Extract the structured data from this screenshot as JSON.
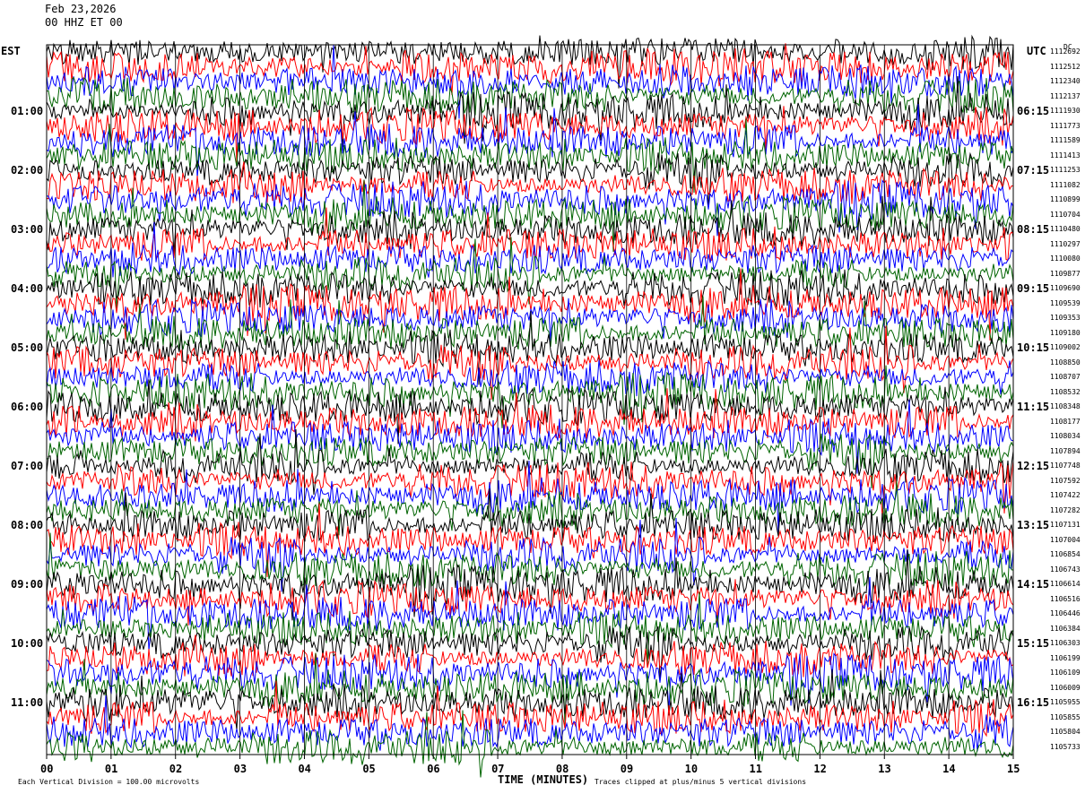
{
  "header": {
    "date": "Feb 23,2026",
    "station_line": "00 HHZ ET 00"
  },
  "labels": {
    "left_timezone": "EST",
    "right_timezone": "UTC",
    "dc_label": "DC",
    "xaxis_title": "TIME (MINUTES)",
    "scale_note": "Each Vertical Division =  100.00 microvolts",
    "clip_note": "Traces clipped at plus/minus 5 vertical divisions"
  },
  "colors": {
    "trace_cycle": [
      "#000000",
      "#ff0000",
      "#0000ff",
      "#006400"
    ],
    "frame": "#000000",
    "grid": "#000000",
    "background": "#ffffff"
  },
  "chart_data": {
    "type": "line",
    "title": "Feb 23,2026",
    "subtitle": "00 HHZ ET 00",
    "xlabel": "TIME (MINUTES)",
    "xlim": [
      0,
      15
    ],
    "x_ticks": [
      "00",
      "01",
      "02",
      "03",
      "04",
      "05",
      "06",
      "07",
      "08",
      "09",
      "10",
      "11",
      "12",
      "13",
      "14",
      "15"
    ],
    "rows": 48,
    "row_minutes": 15,
    "grid": true,
    "scale_microvolts_per_division": 100.0,
    "clip_divisions": 5,
    "est_hour_labels": [
      "01:00",
      "02:00",
      "03:00",
      "04:00",
      "05:00",
      "06:00",
      "07:00",
      "08:00",
      "09:00",
      "10:00",
      "11:00"
    ],
    "utc_hour_labels": [
      "06:15",
      "07:15",
      "08:15",
      "09:15",
      "10:15",
      "11:15",
      "12:15",
      "13:15",
      "14:15",
      "15:15",
      "16:15"
    ],
    "hour_label_start_row": 4,
    "hour_label_every_rows": 4,
    "dc_offsets": [
      "1112692",
      "1112512",
      "1112340",
      "1112137",
      "1111930",
      "1111773",
      "1111589",
      "1111413",
      "1111253",
      "1111082",
      "1110899",
      "1110704",
      "1110480",
      "1110297",
      "1110080",
      "1109877",
      "1109690",
      "1109539",
      "1109353",
      "1109180",
      "1109002",
      "1108850",
      "1108707",
      "1108532",
      "1108348",
      "1108177",
      "1108034",
      "1107894",
      "1107748",
      "1107592",
      "1107422",
      "1107282",
      "1107131",
      "1107004",
      "1106854",
      "1106743",
      "1106614",
      "1106516",
      "1106446",
      "1106384",
      "1106303",
      "1106199",
      "1106109",
      "1106009",
      "1105955",
      "1105855",
      "1105804",
      "1105733"
    ]
  }
}
